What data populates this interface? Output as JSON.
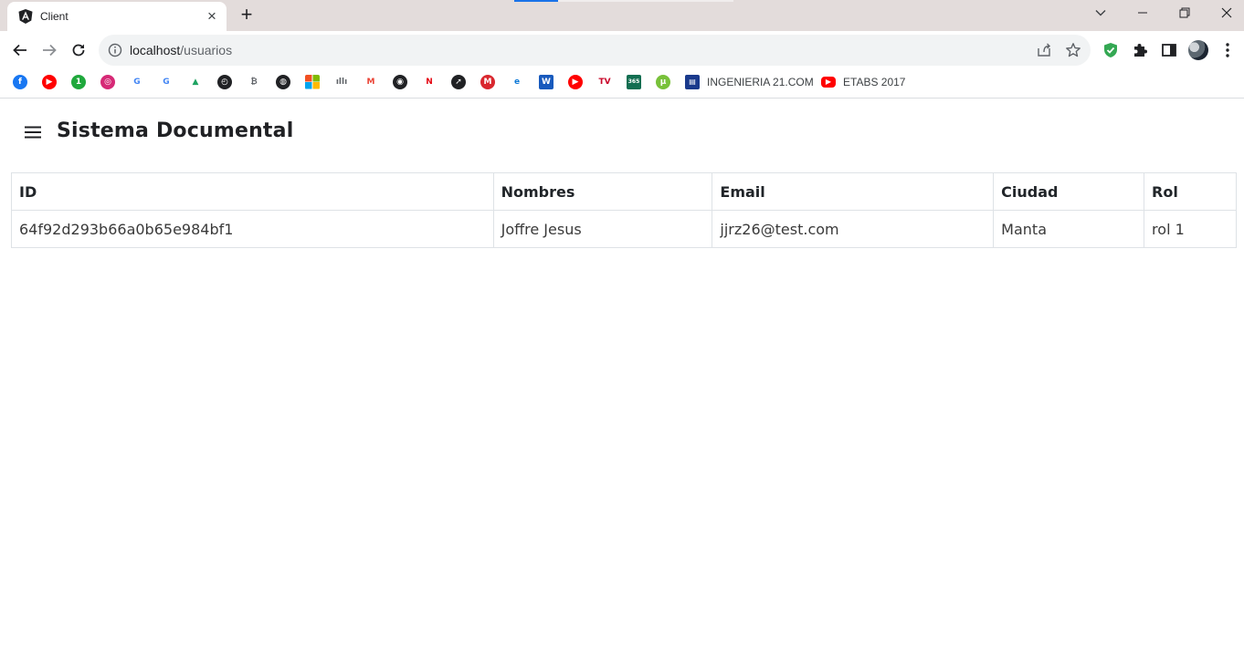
{
  "browser": {
    "tab": {
      "title": "Client"
    },
    "omnibox": {
      "host": "localhost",
      "path": "/usuarios"
    },
    "bookmarks": [
      {
        "icon": "facebook-icon",
        "color": "#1877f2",
        "glyph": "f"
      },
      {
        "icon": "youtube-icon",
        "color": "#ff0000",
        "glyph": "▶"
      },
      {
        "icon": "one-app-icon",
        "color": "#1fa83c",
        "glyph": "1"
      },
      {
        "icon": "instagram-icon",
        "color": "#d62976",
        "glyph": "◎"
      },
      {
        "icon": "google-icon",
        "color": "#ffffff",
        "glyph": "G"
      },
      {
        "icon": "google-icon",
        "color": "#ffffff",
        "glyph": "G"
      },
      {
        "icon": "google-drive-icon",
        "color": "#ffffff",
        "glyph": "▲"
      },
      {
        "icon": "speedometer-icon",
        "color": "#202124",
        "glyph": "◴"
      },
      {
        "icon": "bitcoin-icon",
        "color": "#ffffff",
        "glyph": "₿"
      },
      {
        "icon": "globe-icon",
        "color": "#202124",
        "glyph": "◍"
      },
      {
        "icon": "microsoft-icon",
        "color": "#ffffff",
        "glyph": ""
      },
      {
        "icon": "audio-wave-icon",
        "color": "#ffffff",
        "glyph": "ıllı"
      },
      {
        "icon": "gmail-icon",
        "color": "#ffffff",
        "glyph": "M"
      },
      {
        "icon": "github-icon",
        "color": "#202124",
        "glyph": "◉"
      },
      {
        "icon": "netflix-icon",
        "color": "#ffffff",
        "glyph": "N"
      },
      {
        "icon": "compass-icon",
        "color": "#202124",
        "glyph": "➚"
      },
      {
        "icon": "mega-icon",
        "color": "#d9272e",
        "glyph": "M"
      },
      {
        "icon": "edge-icon",
        "color": "#ffffff",
        "glyph": "e"
      },
      {
        "icon": "word-icon",
        "color": "#185abd",
        "glyph": "W"
      },
      {
        "icon": "youtube-icon",
        "color": "#ff0000",
        "glyph": "▶"
      },
      {
        "icon": "nba-tv-icon",
        "color": "#ffffff",
        "glyph": "TV"
      },
      {
        "icon": "bet365-icon",
        "color": "#126e51",
        "glyph": "365"
      },
      {
        "icon": "utorrent-icon",
        "color": "#78c13a",
        "glyph": "μ"
      }
    ],
    "named_bookmarks": [
      {
        "icon": "site-logo-icon",
        "color": "#1a3a8c",
        "label": "INGENIERIA 21.COM"
      },
      {
        "icon": "youtube-icon",
        "color": "#ff0000",
        "label": "ETABS 2017"
      }
    ]
  },
  "app": {
    "title": "Sistema Documental",
    "table": {
      "columns": [
        "ID",
        "Nombres",
        "Email",
        "Ciudad",
        "Rol"
      ],
      "rows": [
        [
          "64f92d293b66a0b65e984bf1",
          "Joffre Jesus",
          "jjrz26@test.com",
          "Manta",
          "rol 1"
        ]
      ]
    }
  }
}
